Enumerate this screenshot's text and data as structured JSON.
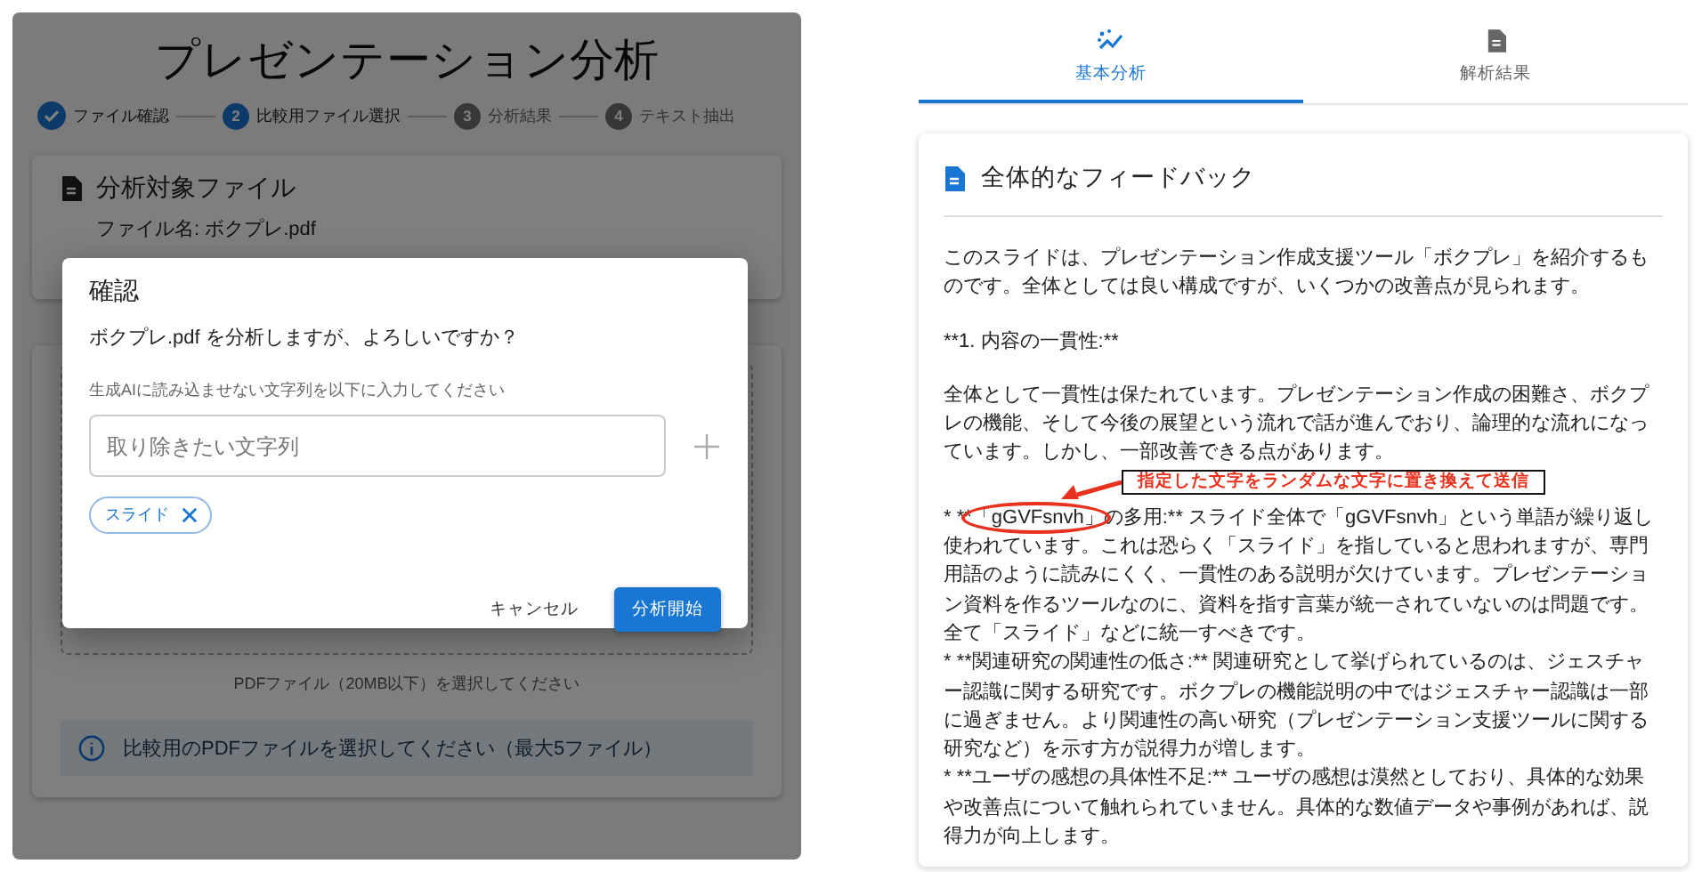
{
  "left_app": {
    "title": "プレゼンテーション分析",
    "steps": [
      {
        "label": "ファイル確認",
        "done": true
      },
      {
        "number": "2",
        "label": "比較用ファイル選択",
        "done": false,
        "active": true
      },
      {
        "number": "3",
        "label": "分析結果",
        "done": false,
        "active": false
      },
      {
        "number": "4",
        "label": "テキスト抽出",
        "done": false,
        "active": false
      }
    ],
    "file_card": {
      "title": "分析対象ファイル",
      "file_name": "ファイル名: ボクプレ.pdf"
    },
    "upload": {
      "hint": "PDFファイル（20MB以下）を選択してください",
      "info": "比較用のPDFファイルを選択してください（最大5ファイル）"
    }
  },
  "dialog": {
    "title": "確認",
    "message": "ボクプレ.pdf を分析しますが、よろしいですか？",
    "helper": "生成AIに読み込ませない文字列を以下に入力してください",
    "input": {
      "placeholder": "取り除きたい文字列"
    },
    "chips": [
      {
        "label": "スライド"
      }
    ],
    "buttons": [
      {
        "label": "キャンセル",
        "kind": "text"
      },
      {
        "label": "分析開始",
        "kind": "primary"
      }
    ]
  },
  "right_app": {
    "tabs": [
      {
        "label": "基本分析",
        "selected": true
      },
      {
        "label": "解析結果",
        "selected": false
      }
    ],
    "card": {
      "title": "全体的なフィードバック",
      "blocks": [
        [
          {
            "kind": "plain",
            "text": "このスライドは、プレゼンテーション作成支援ツール「ボクプレ」を紹介するものです。全体としては良い構成ですが、いくつかの改善点が見られます。"
          }
        ],
        [
          {
            "kind": "plain",
            "text": "**1. 内容の一貫性:**"
          }
        ],
        [
          {
            "kind": "plain",
            "text": "全体として一貫性は保たれています。プレゼンテーション作成の困難さ、ボクプレの機能、そして今後の展望という流れで話が進んでおり、論理的な流れになっています。しかし、一部改善できる点があります。"
          }
        ],
        [
          {
            "kind": "marked",
            "before": "* **",
            "highlight": "「gGVFsnvh」",
            "after": "の多用:** スライド全体で「gGVFsnvh」という単語が繰り返し使われています。これは恐らく「スライド」を指していると思われますが、専門用語のように読みにくく、一貫性のある説明が欠けています。プレゼンテーション資料を作るツールなのに、資料を指す言葉が統一されていないのは問題です。全て「スライド」などに統一すべきです。",
            "callout": "指定した文字をランダムな文字に置き換えて送信"
          },
          {
            "kind": "plain",
            "text": "* **関連研究の関連性の低さ:** 関連研究として挙げられているのは、ジェスチャー認識に関する研究です。ボクプレの機能説明の中ではジェスチャー認識は一部に過ぎません。より関連性の高い研究（プレゼンテーション支援ツールに関する研究など）を示す方が説得力が増します。"
          },
          {
            "kind": "plain",
            "text": "* **ユーザの感想の具体性不足:** ユーザの感想は漠然としており、具体的な効果や改善点について触れられていません。具体的な数値データや事例があれば、説得力が向上します。"
          }
        ]
      ]
    }
  }
}
